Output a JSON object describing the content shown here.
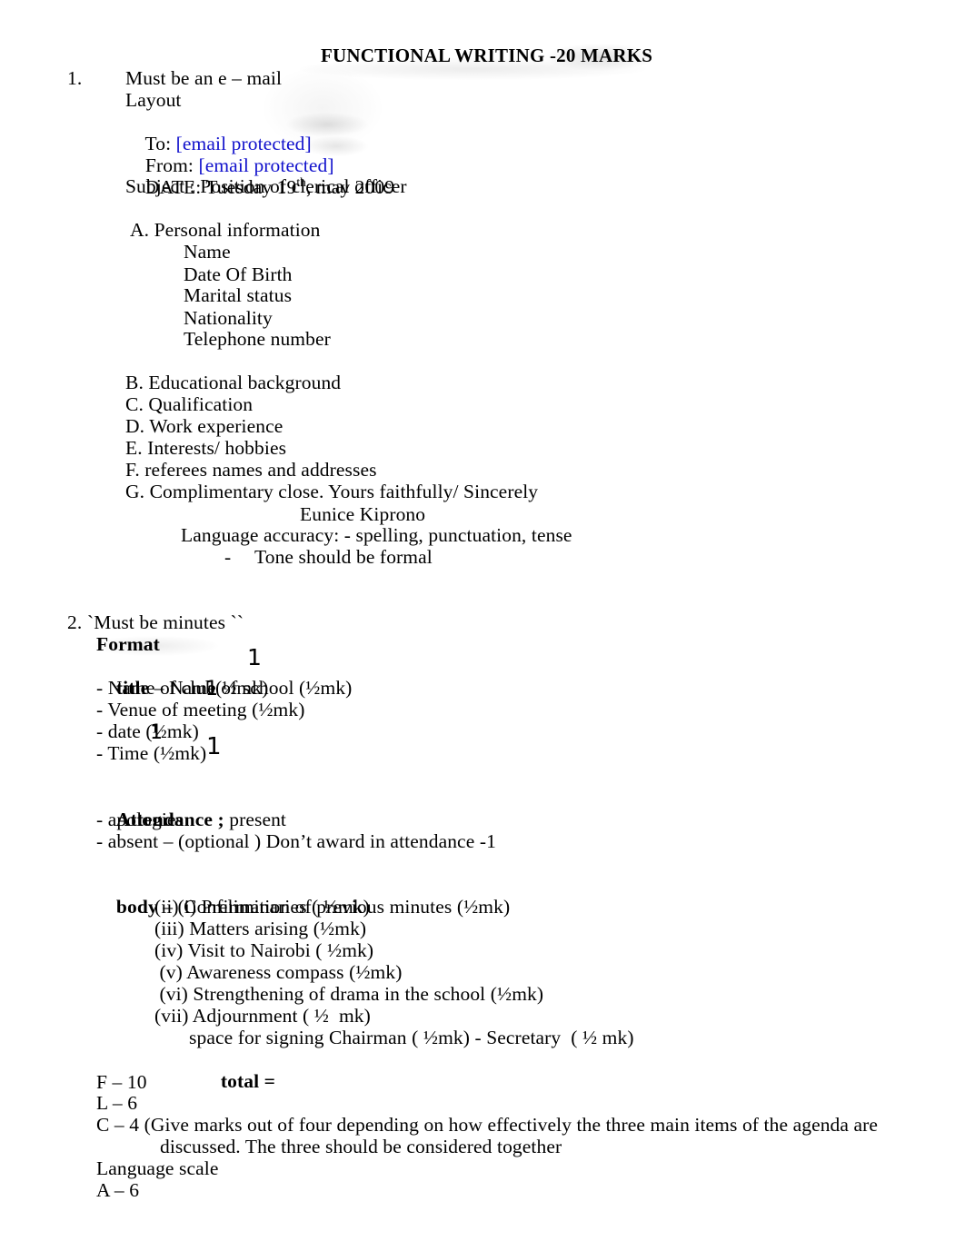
{
  "document": {
    "title": "FUNCTIONAL WRITING -20 MARKS"
  },
  "section_one": {
    "number": "1.",
    "heading": "Must be an e – mail",
    "layout_label": "Layout",
    "to_label": "To: ",
    "to_value": "[email protected]",
    "from_label": "From: ",
    "from_value": "[email protected]",
    "date_prefix": "DATE: Tuesday 19",
    "date_ordinal": "th",
    "date_suffix": ", may 2009",
    "subject": "Subject : Position of clerical officer",
    "part_a": {
      "heading": "A. Personal information",
      "items": [
        "Name",
        "Date Of Birth",
        "Marital status",
        "Nationality",
        "Telephone number"
      ]
    },
    "parts": [
      "B. Educational background",
      "C. Qualification",
      "D. Work experience",
      "E. Interests/ hobbies",
      "F. referees names and addresses",
      "G. Complimentary close. Yours faithfully/ Sincerely"
    ],
    "signature": "Eunice Kiprono",
    "language_accuracy": "Language accuracy: - spelling, punctuation, tense",
    "tone_dash": "-",
    "tone": "Tone should be formal"
  },
  "section_two": {
    "number": "2.",
    "heading": "`Must be minutes ``",
    "format_label": "Format",
    "format_items": [
      {
        "bold_prefix": "title",
        "text": " – Name of school (½mk)"
      },
      {
        "bold_prefix": "",
        "text": "- Name of club(½mk)"
      },
      {
        "bold_prefix": "",
        "text": "- Venue of meeting (½mk)"
      },
      {
        "bold_prefix": "",
        "text": "- date (½mk)"
      },
      {
        "bold_prefix": "",
        "text": "- Time (½mk)"
      }
    ],
    "attendance_label": "Attendance ;",
    "attendance_value": " present",
    "attendance_items": [
      "- apologies",
      "- absent – (optional ) Don’t award in attendance -1"
    ],
    "body_label": "body",
    "body_first": " – (i) Preliminaries ( ½mk)",
    "body_items": [
      "(ii) Confirmation of previous minutes (½mk)",
      "(iii) Matters arising (½mk)",
      "(iv) Visit to Nairobi ( ½mk)",
      " (v) Awareness compass (½mk)",
      " (vi) Strengthening of drama in the school (½mk)",
      "(vii) Adjournment ( ½  mk)"
    ],
    "signing_space": "space for signing Chairman ( ½mk) - Secretary  ( ½ mk)",
    "total_label": "total",
    "total_value": " =",
    "scores": [
      "F – 10",
      "L – 6"
    ],
    "criterion_c_line1": "C – 4 (Give marks out of four depending on how effectively the three main items of the agenda are",
    "criterion_c_line2": "discussed. The three should be considered together",
    "language_scale_label": "Language scale",
    "language_scale_value": "A – 6"
  },
  "annotations": {
    "marks": [
      {
        "value": "1",
        "name": "annotation-mark-school"
      },
      {
        "value": "1",
        "name": "annotation-mark-club"
      },
      {
        "value": "1",
        "name": "annotation-mark-date"
      },
      {
        "value": "1",
        "name": "annotation-mark-time"
      }
    ]
  },
  "colors": {
    "link": "#1111cc",
    "text": "#000000",
    "page_background": "#ffffff"
  }
}
